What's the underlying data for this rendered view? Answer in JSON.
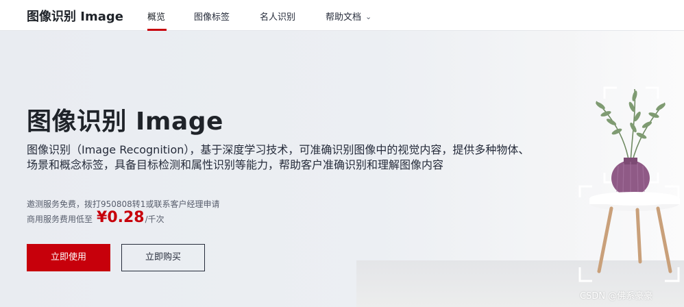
{
  "header": {
    "brand": "图像识别 Image",
    "nav": [
      {
        "label": "概览",
        "active": true
      },
      {
        "label": "图像标签",
        "active": false
      },
      {
        "label": "名人识别",
        "active": false
      },
      {
        "label": "帮助文档",
        "active": false,
        "has_dropdown": true
      }
    ]
  },
  "hero": {
    "title": "图像识别 Image",
    "description": "图像识别（Image Recognition），基于深度学习技术，可准确识别图像中的视觉内容，提供多种物体、场景和概念标签，具备目标检测和属性识别等能力，帮助客户准确识别和理解图像内容",
    "trial_note": "邀测服务免费，拨打950808转1或联系客户经理申请",
    "price_prefix": "商用服务费用低至",
    "price": "¥0.28",
    "price_unit": "/千次",
    "primary_button": "立即使用",
    "secondary_button": "立即购买"
  },
  "watermark": "CSDN @佛系豪豪",
  "colors": {
    "accent": "#c7000b",
    "text": "#1f2329",
    "hero_bg": "#eceff3"
  },
  "icons": [
    "chevron-down-icon",
    "vase-plant-illustration"
  ]
}
